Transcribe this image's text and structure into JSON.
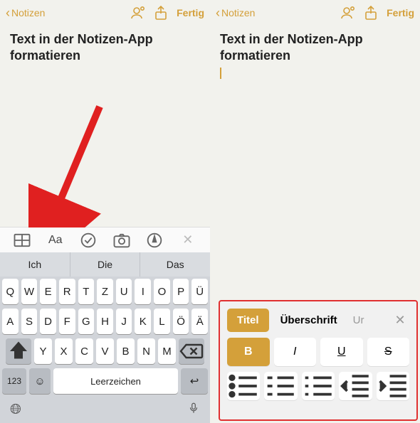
{
  "nav": {
    "back": "Notizen",
    "done": "Fertig"
  },
  "note": {
    "title": "Text in der Notizen-App formatieren"
  },
  "suggestions": [
    "Ich",
    "Die",
    "Das"
  ],
  "keyboard": {
    "row1": [
      "Q",
      "W",
      "E",
      "R",
      "T",
      "Z",
      "U",
      "I",
      "O",
      "P",
      "Ü"
    ],
    "row2": [
      "A",
      "S",
      "D",
      "F",
      "G",
      "H",
      "J",
      "K",
      "L",
      "Ö",
      "Ä"
    ],
    "row3": [
      "Y",
      "X",
      "C",
      "V",
      "B",
      "N",
      "M"
    ],
    "space": "Leerzeichen",
    "numkey": "123"
  },
  "format": {
    "title": "Titel",
    "heading": "Überschrift",
    "partial": "Ur",
    "bold": "B",
    "italic": "I",
    "underline": "U",
    "strike": "S"
  }
}
